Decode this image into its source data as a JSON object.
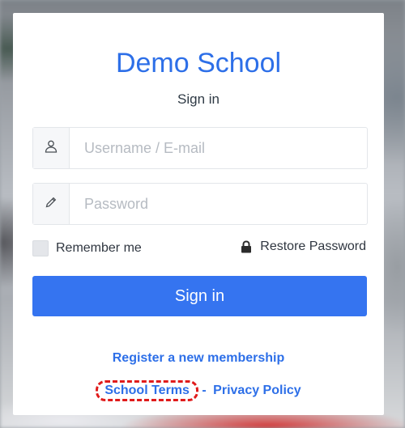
{
  "app": {
    "title": "Demo School",
    "subtitle": "Sign in"
  },
  "form": {
    "username": {
      "placeholder": "Username / E-mail",
      "value": "",
      "icon": "user-icon"
    },
    "password": {
      "placeholder": "Password",
      "value": "",
      "icon": "pencil-icon"
    },
    "remember_label": "Remember me",
    "remember_checked": false,
    "restore_label": "Restore Password",
    "restore_icon": "lock-icon",
    "submit_label": "Sign in"
  },
  "links": {
    "register": "Register a new membership",
    "terms": "School Terms",
    "separator": "-",
    "privacy": "Privacy Policy"
  },
  "colors": {
    "brand": "#2d6fe8",
    "button": "#3574f0",
    "highlight": "#e01b1b"
  }
}
